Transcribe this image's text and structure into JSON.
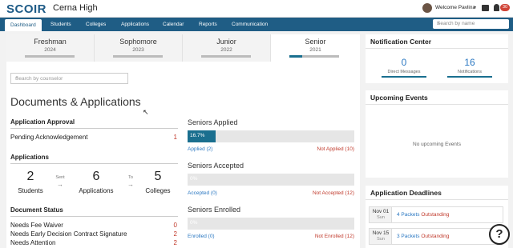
{
  "topbar": {
    "logo": "SCOIR",
    "school": "Cerna High",
    "welcome": "Welcome Pavlina",
    "notification_badge": "30"
  },
  "nav": {
    "items": [
      "Dashboard",
      "Students",
      "Colleges",
      "Applications",
      "Calendar",
      "Reports",
      "Communication"
    ],
    "search_placeholder": "Search by name"
  },
  "grades": [
    {
      "name": "Freshman",
      "year": "2024",
      "progress": 0
    },
    {
      "name": "Sophomore",
      "year": "2023",
      "progress": 0
    },
    {
      "name": "Junior",
      "year": "2022",
      "progress": 0
    },
    {
      "name": "Senior",
      "year": "2021",
      "progress": 0.25
    }
  ],
  "counselor_placeholder": "Search by counselor",
  "documents_title": "Documents & Applications",
  "approval": {
    "title": "Application Approval",
    "rows": [
      {
        "label": "Pending Acknowledgement",
        "count": "1"
      }
    ]
  },
  "applications": {
    "title": "Applications",
    "students_num": "2",
    "students_lbl": "Students",
    "sent_lbl": "Sent",
    "apps_num": "6",
    "apps_lbl": "Applications",
    "to_lbl": "To",
    "colleges_num": "5",
    "colleges_lbl": "Colleges"
  },
  "doc_status": {
    "title": "Document Status",
    "rows": [
      {
        "label": "Needs Fee Waiver",
        "count": "0"
      },
      {
        "label": "Needs Early Decision Contract Signature",
        "count": "2"
      },
      {
        "label": "Needs Attention",
        "count": "2"
      }
    ]
  },
  "seniors": {
    "applied": {
      "title": "Seniors Applied",
      "pct_label": "16.7%",
      "pct": 0.167,
      "left": "Applied (2)",
      "right": "Not Applied (10)"
    },
    "accepted": {
      "title": "Seniors Accepted",
      "pct_label": "0%",
      "pct": 0,
      "left": "Accepted (0)",
      "right": "Not Accepted (12)"
    },
    "enrolled": {
      "title": "Seniors Enrolled",
      "pct_label": "0%",
      "pct": 0,
      "left": "Enrolled (0)",
      "right": "Not Enrolled (12)"
    }
  },
  "notification_center": {
    "title": "Notification Center",
    "direct_num": "0",
    "direct_lbl": "Direct Messages",
    "notif_num": "16",
    "notif_lbl": "Notifications"
  },
  "events": {
    "title": "Upcoming Events",
    "empty": "No upcoming Events"
  },
  "deadlines": {
    "title": "Application Deadlines",
    "items": [
      {
        "day": "Nov 01",
        "dow": "Sun",
        "packets": "4 Packets",
        "status": "Outstanding"
      },
      {
        "day": "Nov 15",
        "dow": "Sun",
        "packets": "3 Packets",
        "status": "Outstanding"
      }
    ]
  },
  "colors": {
    "nav": "#1f5d85",
    "accent": "#1a6f8f",
    "link": "#2b78c2",
    "alert": "#c0392b"
  }
}
